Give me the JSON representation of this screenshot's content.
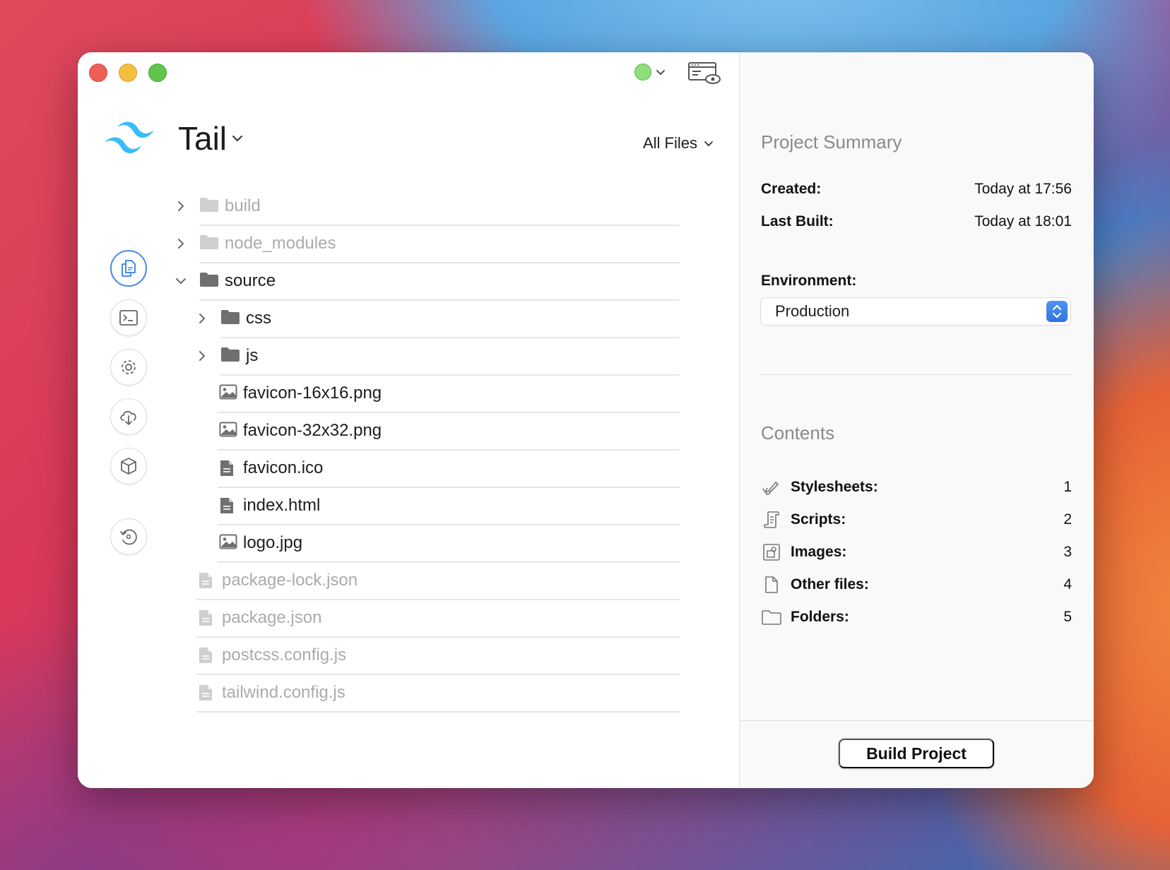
{
  "window": {
    "project_name": "Tail",
    "filter_label": "All Files"
  },
  "sidebar": {
    "items": [
      {
        "name": "files",
        "icon": "files-icon"
      },
      {
        "name": "terminal",
        "icon": "terminal-icon"
      },
      {
        "name": "settings",
        "icon": "gear-icon"
      },
      {
        "name": "deploy",
        "icon": "cloud-download-icon"
      },
      {
        "name": "packages",
        "icon": "package-icon"
      },
      {
        "name": "history",
        "icon": "history-icon"
      }
    ]
  },
  "tree": [
    {
      "name": "build",
      "type": "folder",
      "depth": 0,
      "dim": true,
      "expanded": false
    },
    {
      "name": "node_modules",
      "type": "folder",
      "depth": 0,
      "dim": true,
      "expanded": false
    },
    {
      "name": "source",
      "type": "folder",
      "depth": 0,
      "dim": false,
      "expanded": true
    },
    {
      "name": "css",
      "type": "folder",
      "depth": 1,
      "dim": false,
      "expanded": false
    },
    {
      "name": "js",
      "type": "folder",
      "depth": 1,
      "dim": false,
      "expanded": false
    },
    {
      "name": "favicon-16x16.png",
      "type": "image",
      "depth": 1,
      "dim": false
    },
    {
      "name": "favicon-32x32.png",
      "type": "image",
      "depth": 1,
      "dim": false
    },
    {
      "name": "favicon.ico",
      "type": "file",
      "depth": 1,
      "dim": false
    },
    {
      "name": "index.html",
      "type": "file",
      "depth": 1,
      "dim": false
    },
    {
      "name": "logo.jpg",
      "type": "image",
      "depth": 1,
      "dim": false
    },
    {
      "name": "package-lock.json",
      "type": "file",
      "depth": 0,
      "dim": true
    },
    {
      "name": "package.json",
      "type": "file",
      "depth": 0,
      "dim": true
    },
    {
      "name": "postcss.config.js",
      "type": "file",
      "depth": 0,
      "dim": true
    },
    {
      "name": "tailwind.config.js",
      "type": "file",
      "depth": 0,
      "dim": true
    }
  ],
  "summary": {
    "title": "Project Summary",
    "created_label": "Created:",
    "created_value": "Today at 17:56",
    "last_built_label": "Last Built:",
    "last_built_value": "Today at 18:01",
    "environment_label": "Environment:",
    "environment_value": "Production"
  },
  "contents": {
    "title": "Contents",
    "items": [
      {
        "label": "Stylesheets:",
        "value": "1",
        "icon": "brush-icon"
      },
      {
        "label": "Scripts:",
        "value": "2",
        "icon": "script-icon"
      },
      {
        "label": "Images:",
        "value": "3",
        "icon": "image-icon"
      },
      {
        "label": "Other files:",
        "value": "4",
        "icon": "document-icon"
      },
      {
        "label": "Folders:",
        "value": "5",
        "icon": "folder-icon"
      }
    ]
  },
  "footer": {
    "build_label": "Build Project"
  },
  "colors": {
    "accent": "#4a8be8",
    "status_green": "#8fe07d",
    "tailwind_logo": "#38bdf8"
  }
}
